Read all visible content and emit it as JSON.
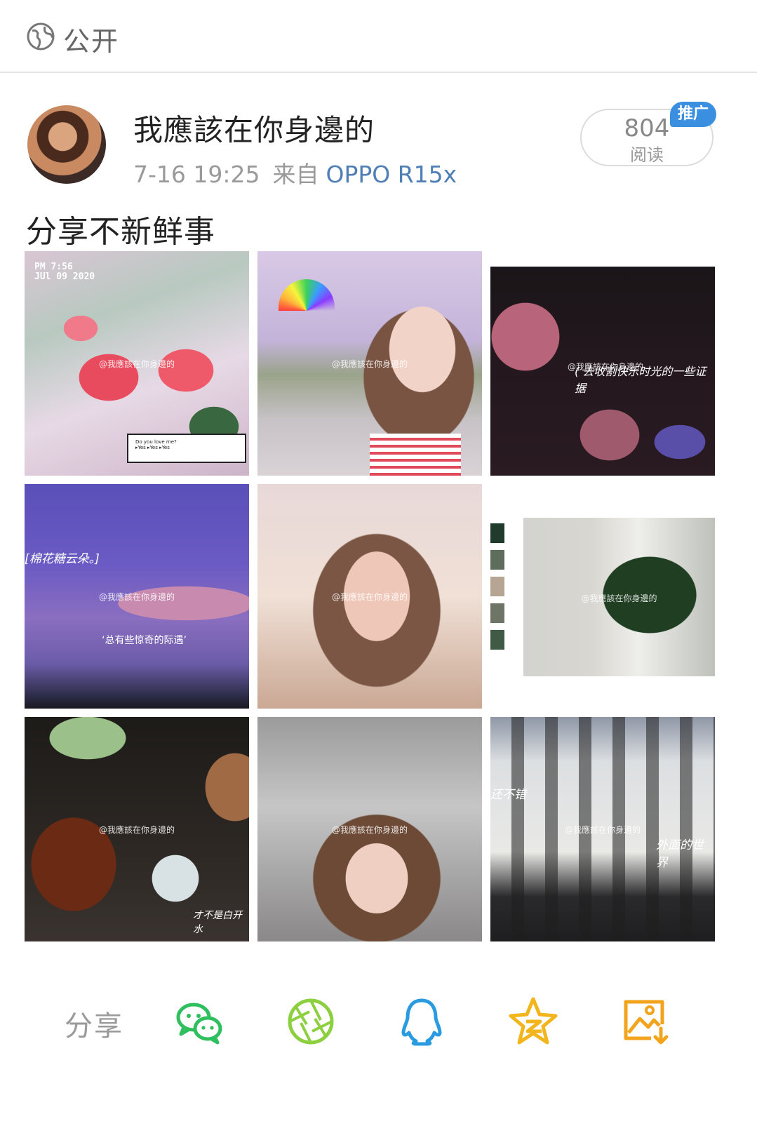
{
  "privacy": {
    "icon": "globe-icon",
    "label": "公开"
  },
  "post": {
    "author": "我應該在你身邊的",
    "time": "7-16 19:25",
    "from_label": "来自",
    "device": "OPPO R15x",
    "reads_count": "804",
    "reads_label": "阅读",
    "promo_badge": "推广",
    "text": "分享不新鲜事"
  },
  "images": {
    "watermark": "@我應該在你身邊的",
    "img1_stamp": "PM 7:56\nJUl 09 2020",
    "img1_dialog": "Do you love me?\n▸Yes ▸Yes ▸Yes",
    "img3_caption": "( 去收割快乐时光的一些证据",
    "img4_caption_1": "[棉花糖云朵。]",
    "img4_caption_2": "‘总有些惊奇的际遇’",
    "img7_caption": "才不是白开水",
    "img9_caption_1": "还不错",
    "img9_caption_2": "外面的世界"
  },
  "share": {
    "label": "分享",
    "targets": [
      "wechat-icon",
      "moments-icon",
      "qq-icon",
      "qzone-icon",
      "save-image-icon"
    ]
  },
  "colors": {
    "link": "#4f7fb5",
    "promo": "#3a8fe0",
    "wechat": "#2fbf5f",
    "moments": "#8ccf3f",
    "qq": "#2a9be0",
    "qzone": "#f2b51c",
    "save": "#f2a51c"
  }
}
